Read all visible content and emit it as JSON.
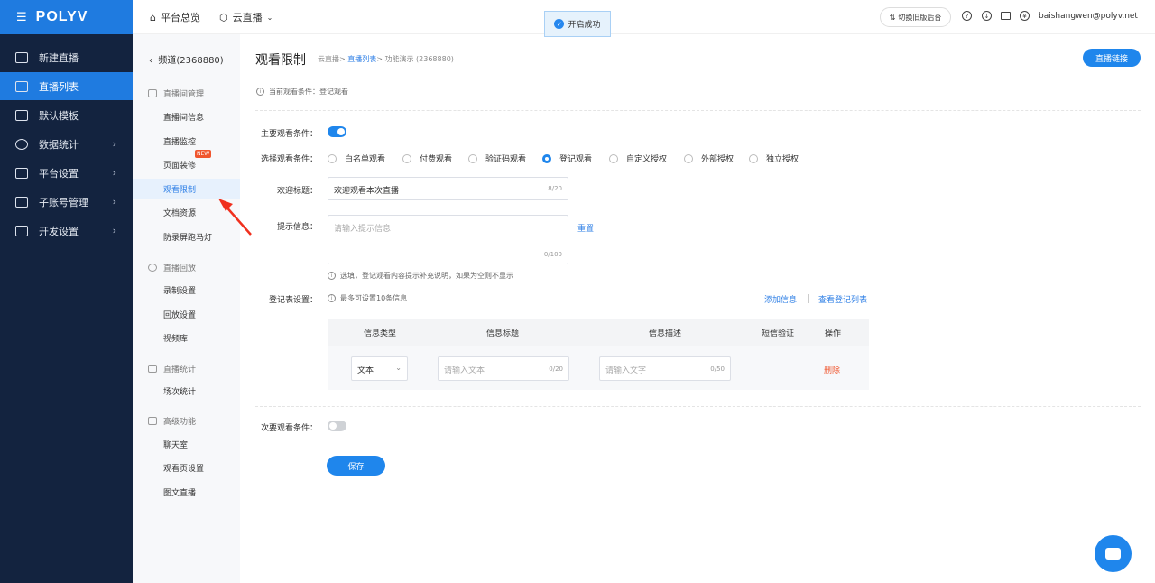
{
  "logo": {
    "brand": "POLYV"
  },
  "sidebar": {
    "items": [
      {
        "label": "新建直播",
        "has_arrow": false
      },
      {
        "label": "直播列表",
        "has_arrow": false,
        "active": true
      },
      {
        "label": "默认模板",
        "has_arrow": false
      },
      {
        "label": "数据统计",
        "has_arrow": true
      },
      {
        "label": "平台设置",
        "has_arrow": true
      },
      {
        "label": "子账号管理",
        "has_arrow": true
      },
      {
        "label": "开发设置",
        "has_arrow": true
      }
    ],
    "arrow": "›"
  },
  "topbar": {
    "overview": "平台总览",
    "cloud_live": "云直播",
    "toast": "开启成功",
    "switch_old": "切换旧版后台",
    "user_email": "baishangwen@polyv.net"
  },
  "subnav": {
    "back": "频道(2368880)",
    "groups": {
      "room_mgmt": "直播间管理",
      "replay": "直播回放",
      "stats": "直播统计",
      "advanced": "高级功能"
    },
    "items": {
      "room_info": "直播间信息",
      "monitor": "直播监控",
      "page_decor": "页面装修",
      "view_restrict": "观看限制",
      "docs": "文档资源",
      "marquee": "防录屏跑马灯",
      "record": "录制设置",
      "replay_settings": "回放设置",
      "video_lib": "视频库",
      "session_stats": "场次统计",
      "chatroom": "聊天室",
      "watch_page": "观看页设置",
      "graphic_live": "图文直播"
    },
    "new_badge": "NEW"
  },
  "page": {
    "title": "观看限制",
    "crumb_1": "云直播",
    "crumb_2": "直播列表",
    "crumb_3": "功能演示 (2368880)",
    "live_link_btn": "直播链接",
    "current_condition": "当前观看条件：登记观看"
  },
  "form": {
    "main_cond_label": "主要观看条件：",
    "main_cond_on": true,
    "select_cond_label": "选择观看条件：",
    "options": [
      "白名单观看",
      "付费观看",
      "验证码观看",
      "登记观看",
      "自定义授权",
      "外部授权",
      "独立授权"
    ],
    "selected_option": "登记观看",
    "welcome_label": "欢迎标题：",
    "welcome_value": "欢迎观看本次直播",
    "welcome_count": "8/20",
    "hint_label": "提示信息：",
    "hint_placeholder": "请输入提示信息",
    "hint_count": "0/100",
    "reset": "重置",
    "hint_note": "选填，登记观看内容提示补充说明，如果为空则不显示",
    "reg_label": "登记表设置：",
    "reg_note": "最多可设置10条信息",
    "add_info": "添加信息",
    "view_list": "查看登记列表",
    "secondary_label": "次要观看条件：",
    "secondary_on": false,
    "save": "保存"
  },
  "reg_table": {
    "headers": [
      "信息类型",
      "信息标题",
      "信息描述",
      "短信验证",
      "操作"
    ],
    "row": {
      "type_value": "文本",
      "title_placeholder": "请输入文本",
      "title_count": "0/20",
      "desc_placeholder": "请输入文字",
      "desc_count": "0/50",
      "delete": "删除"
    }
  },
  "colors": {
    "primary": "#1f86ec",
    "sidebar_bg": "#13233f",
    "danger": "#f0562e",
    "annotation_arrow": "#f0301e"
  }
}
